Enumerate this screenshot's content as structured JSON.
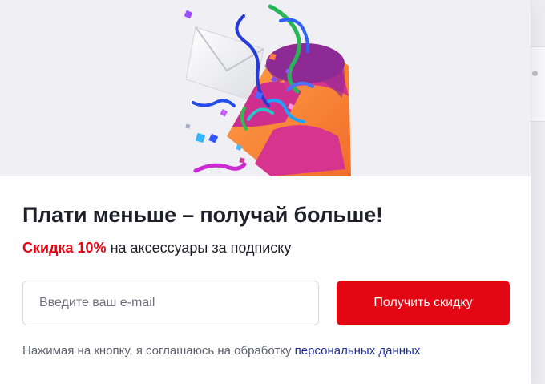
{
  "modal": {
    "close_icon": "close-icon",
    "hero_icons": [
      "envelope-icon",
      "party-popper-icon",
      "confetti-icon"
    ],
    "title": "Плати меньше – получай больше!",
    "subtitle": {
      "discount": "Скидка 10%",
      "rest": "на аксессуары за подписку"
    },
    "email_input": {
      "placeholder": "Введите ваш e-mail",
      "value": ""
    },
    "submit_button": "Получить скидку",
    "consent": {
      "text": "Нажимая на кнопку, я соглашаюсь на обработку",
      "link": "персональных данных"
    }
  },
  "colors": {
    "accent": "#e30613",
    "title": "#1e1f28",
    "link": "#1f2f9d",
    "muted_text": "#5e6070",
    "hero_background": "#efeff4"
  }
}
